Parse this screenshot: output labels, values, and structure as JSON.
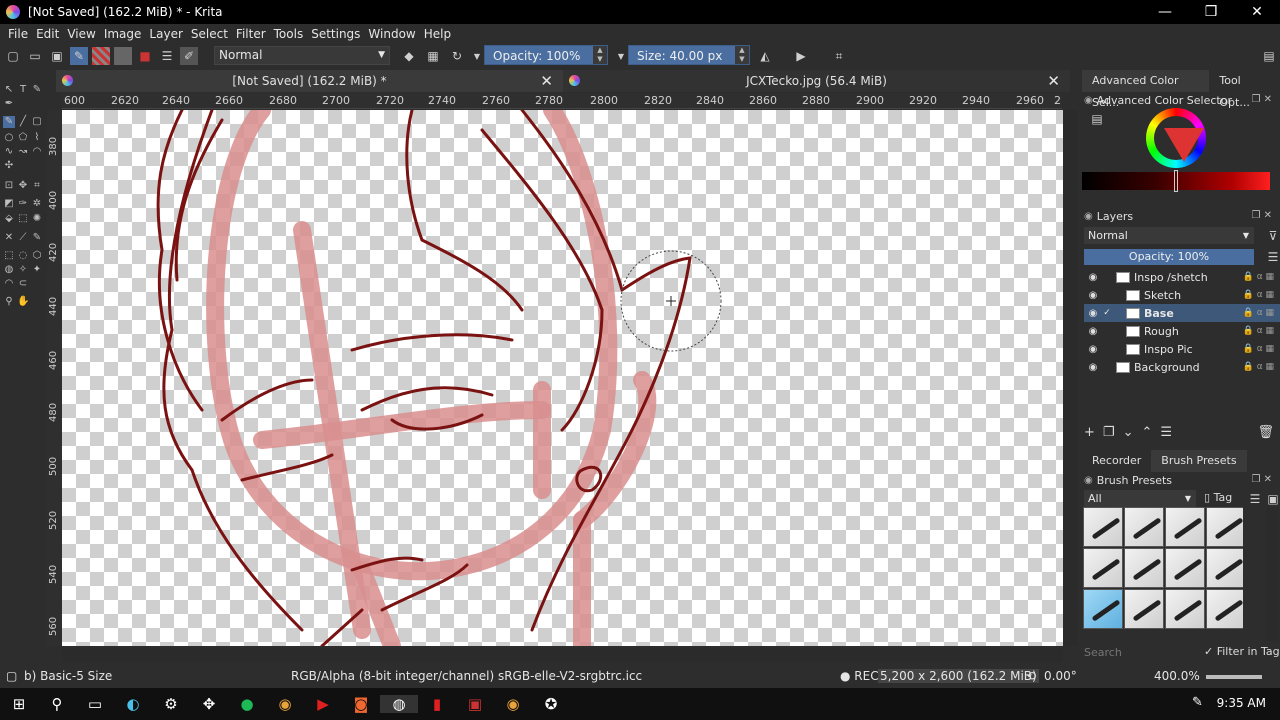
{
  "window": {
    "title": "[Not Saved]  (162.2 MiB) * - Krita",
    "minimize": "—",
    "restore": "❒",
    "close": "✕"
  },
  "menu": [
    "File",
    "Edit",
    "View",
    "Image",
    "Layer",
    "Select",
    "Filter",
    "Tools",
    "Settings",
    "Window",
    "Help"
  ],
  "toolbar": {
    "blend_mode": "Normal",
    "opacity": "Opacity: 100%",
    "size": "Size: 40.00 px"
  },
  "tabs": [
    {
      "label": "[Not Saved]  (162.2 MiB) *",
      "close": "✕"
    },
    {
      "label": "JCXTecko.jpg (56.4 MiB)",
      "close": "✕"
    }
  ],
  "ruler_h": [
    "600",
    "2620",
    "2640",
    "2660",
    "2680",
    "2700",
    "2720",
    "2740",
    "2760",
    "2780",
    "2800",
    "2820",
    "2840",
    "2860",
    "2880",
    "2900",
    "2920",
    "2940",
    "2960",
    "2"
  ],
  "ruler_v": [
    "380",
    "400",
    "420",
    "440",
    "460",
    "480",
    "500",
    "520",
    "540",
    "560"
  ],
  "dock": {
    "tabs": [
      "Advanced Color Sel...",
      "Tool Opt..."
    ],
    "color_panel_title": "Advanced Color Selector",
    "layers_title": "Layers",
    "layer_blend": "Normal",
    "layer_opacity": "Opacity:  100%",
    "layers": [
      {
        "name": "Inspo /shetch",
        "selected": false
      },
      {
        "name": "Sketch",
        "selected": false
      },
      {
        "name": "Base",
        "selected": true
      },
      {
        "name": "Rough",
        "selected": false
      },
      {
        "name": "Inspo Pic",
        "selected": false
      },
      {
        "name": "Background",
        "selected": false
      }
    ],
    "bottom_tabs": [
      "Recorder",
      "Brush Presets"
    ],
    "brush_presets_title": "Brush Presets",
    "brush_filter": "All",
    "tag_label": "Tag",
    "search_placeholder": "Search",
    "filter_in_tag": "Filter in Tag"
  },
  "status": {
    "brush": "b) Basic-5 Size",
    "color_space": "RGB/Alpha (8-bit integer/channel)  sRGB-elle-V2-srgbtrc.icc",
    "rec": "● REC",
    "dimensions": "5,200 x 2,600 (162.2 MiB)",
    "rotation": "0.00°",
    "zoom": "400.0%"
  },
  "taskbar": {
    "time": "9:35 AM"
  }
}
